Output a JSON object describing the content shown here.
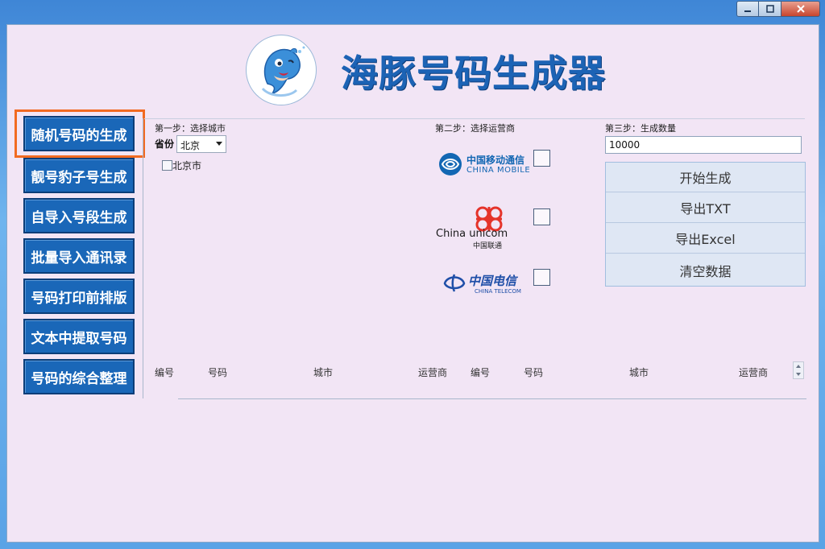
{
  "app": {
    "title": "海豚号码生成器"
  },
  "nav": {
    "items": [
      {
        "label": "随机号码的生成",
        "active": true
      },
      {
        "label": "靓号豹子号生成"
      },
      {
        "label": "自导入号段生成"
      },
      {
        "label": "批量导入通讯录"
      },
      {
        "label": "号码打印前排版"
      },
      {
        "label": "文本中提取号码"
      },
      {
        "label": "号码的综合整理"
      }
    ]
  },
  "step1": {
    "title": "第一步：选择城市",
    "province_label": "省份",
    "province_value": "北京",
    "city_option": "北京市"
  },
  "step2": {
    "title": "第二步：选择运营商",
    "operators": [
      {
        "cn": "中国移动通信",
        "en": "CHINA MOBILE",
        "checked": false
      },
      {
        "cn": "中国联通",
        "en": "China unicom",
        "checked": false
      },
      {
        "cn": "中国电信",
        "en": "CHINA TELECOM",
        "checked": false
      }
    ]
  },
  "step3": {
    "title": "第三步：生成数量",
    "quantity": "10000"
  },
  "actions": {
    "start": "开始生成",
    "export_txt": "导出TXT",
    "export_excel": "导出Excel",
    "clear": "清空数据"
  },
  "table": {
    "columns": [
      "编号",
      "号码",
      "城市",
      "运营商",
      "编号",
      "号码",
      "城市",
      "运营商"
    ]
  },
  "colors": {
    "nav_bg": "#1a67b8",
    "title": "#1c63b5",
    "highlight": "#f26a21",
    "client_bg": "#f2e5f5"
  }
}
